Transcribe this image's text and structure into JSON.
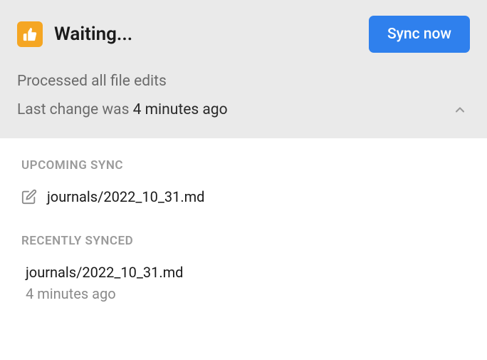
{
  "header": {
    "status_title": "Waiting...",
    "sync_button_label": "Sync now",
    "processed_text": "Processed all file edits",
    "last_change_prefix": "Last change was ",
    "last_change_time": "4 minutes ago"
  },
  "upcoming": {
    "title": "UPCOMING SYNC",
    "items": [
      {
        "path": "journals/2022_10_31.md"
      }
    ]
  },
  "recent": {
    "title": "RECENTLY SYNCED",
    "items": [
      {
        "path": "journals/2022_10_31.md",
        "time": "4 minutes ago"
      }
    ]
  }
}
